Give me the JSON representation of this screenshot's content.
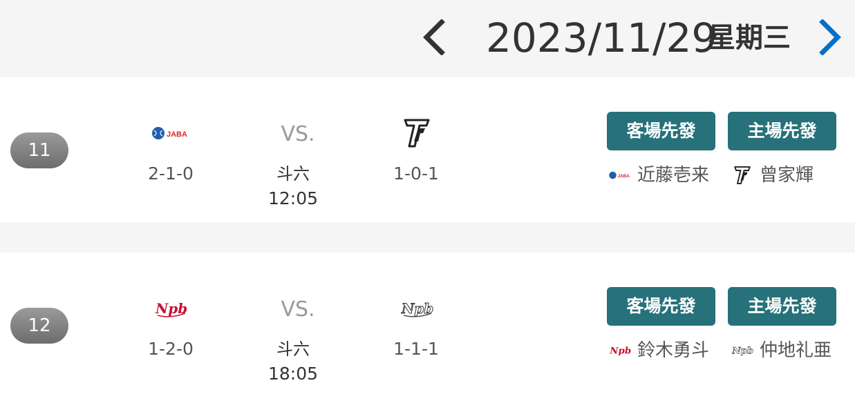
{
  "header": {
    "date": "2023/11/29",
    "weekday": "星期三",
    "prev_icon": "chevron-left-icon",
    "next_icon": "chevron-right-icon",
    "next_color": "#0070c9"
  },
  "games": [
    {
      "number": "11",
      "away": {
        "logo": "jaba-logo",
        "record": "2-1-0",
        "starter": "近藤壱来"
      },
      "home": {
        "logo": "tainan-t-logo",
        "record": "1-0-1",
        "starter": "曾家輝"
      },
      "vs": "VS.",
      "venue": "斗六",
      "time": "12:05",
      "away_starter_label": "客場先發",
      "home_starter_label": "主場先發"
    },
    {
      "number": "12",
      "away": {
        "logo": "npb-red-logo",
        "record": "1-2-0",
        "starter": "鈴木勇斗"
      },
      "home": {
        "logo": "npb-white-logo",
        "record": "1-1-1",
        "starter": "仲地礼亜"
      },
      "vs": "VS.",
      "venue": "斗六",
      "time": "18:05",
      "away_starter_label": "客場先發",
      "home_starter_label": "主場先發"
    }
  ],
  "colors": {
    "button_bg": "#26717a",
    "badge_bg": "#808080"
  }
}
